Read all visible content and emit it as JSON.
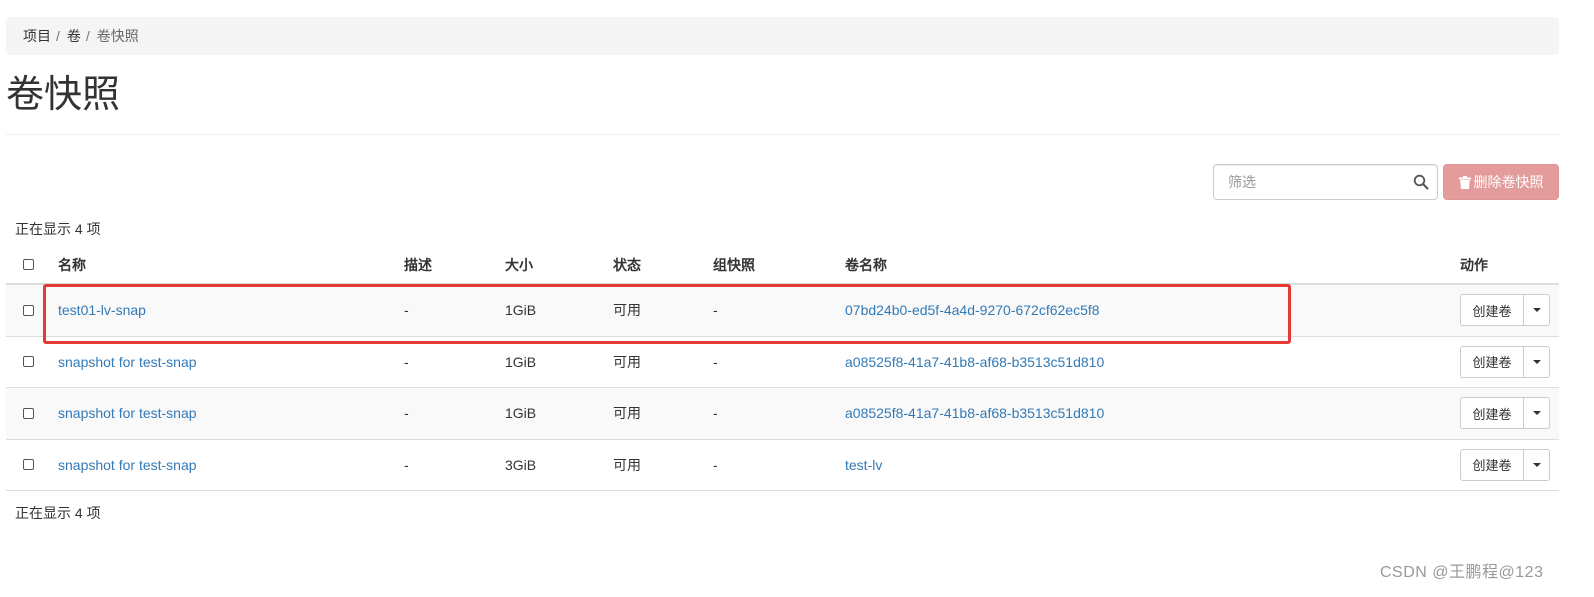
{
  "breadcrumb": {
    "items": [
      "项目",
      "卷"
    ],
    "current": "卷快照"
  },
  "page_title": "卷快照",
  "filter": {
    "placeholder": "筛选",
    "icon": "search-icon"
  },
  "toolbar": {
    "delete_label": "删除卷快照",
    "delete_icon": "trash-icon",
    "delete_color": "#e39c9b"
  },
  "count_top": "正在显示 4 项",
  "count_bottom": "正在显示 4 项",
  "table": {
    "columns": [
      "名称",
      "描述",
      "大小",
      "状态",
      "组快照",
      "卷名称",
      "动作"
    ],
    "rows": [
      {
        "name": "test01-lv-snap",
        "description": "-",
        "size": "1GiB",
        "status": "可用",
        "group_snapshot": "-",
        "volume_name": "07bd24b0-ed5f-4a4d-9270-672cf62ec5f8",
        "action": "创建卷"
      },
      {
        "name": "snapshot for test-snap",
        "description": "-",
        "size": "1GiB",
        "status": "可用",
        "group_snapshot": "-",
        "volume_name": "a08525f8-41a7-41b8-af68-b3513c51d810",
        "action": "创建卷"
      },
      {
        "name": "snapshot for test-snap",
        "description": "-",
        "size": "1GiB",
        "status": "可用",
        "group_snapshot": "-",
        "volume_name": "a08525f8-41a7-41b8-af68-b3513c51d810",
        "action": "创建卷"
      },
      {
        "name": "snapshot for test-snap",
        "description": "-",
        "size": "3GiB",
        "status": "可用",
        "group_snapshot": "-",
        "volume_name": "test-lv",
        "action": "创建卷"
      }
    ]
  },
  "highlight_color": "#e53935",
  "link_color": "#337ab7",
  "watermark": "CSDN @王鹏程@123"
}
